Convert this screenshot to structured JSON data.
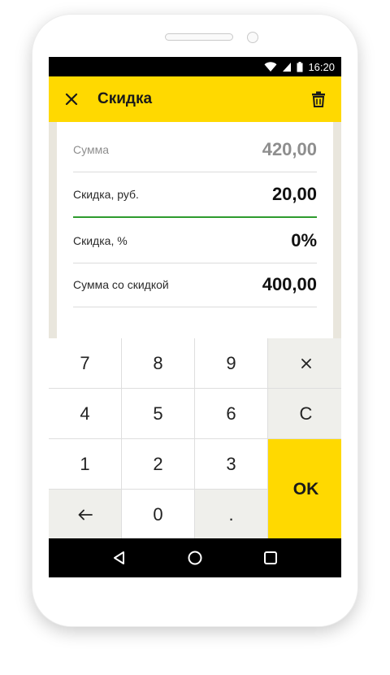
{
  "status": {
    "time": "16:20"
  },
  "toolbar": {
    "title": "Скидка"
  },
  "fields": [
    {
      "label": "Сумма",
      "value": "420,00"
    },
    {
      "label": "Скидка, руб.",
      "value": "20,00"
    },
    {
      "label": "Скидка, %",
      "value": "0%"
    },
    {
      "label": "Сумма со скидкой",
      "value": "400,00"
    }
  ],
  "keypad": {
    "k7": "7",
    "k8": "8",
    "k9": "9",
    "k4": "4",
    "k5": "5",
    "k6": "6",
    "k1": "1",
    "k2": "2",
    "k3": "3",
    "k0": "0",
    "dot": ".",
    "clear": "C",
    "ok": "OK"
  },
  "colors": {
    "accent": "#ffd900",
    "active_underline": "#2e9b2e",
    "muted_text": "#8e8e8e"
  },
  "icons": {
    "close": "close-icon",
    "trash": "trash-icon",
    "multiply": "multiply-icon",
    "backspace": "arrow-left-icon",
    "nav_back": "nav-back-icon",
    "nav_home": "nav-home-icon",
    "nav_recents": "nav-recents-icon"
  }
}
